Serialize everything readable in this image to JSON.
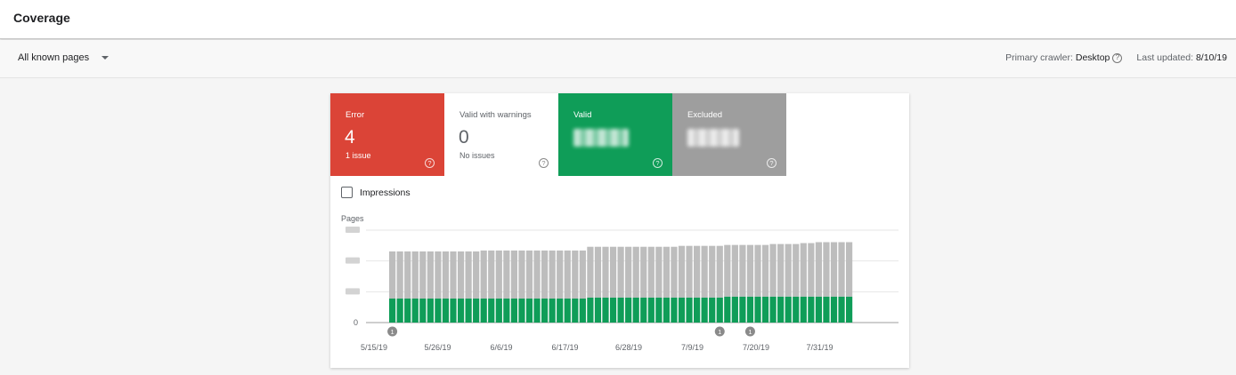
{
  "header": {
    "title": "Coverage"
  },
  "filter": {
    "page_select": "All known pages",
    "crawler_label": "Primary crawler:",
    "crawler_value": "Desktop",
    "updated_label": "Last updated:",
    "updated_value": "8/10/19"
  },
  "tiles": {
    "error": {
      "label": "Error",
      "value": "4",
      "sub": "1 issue",
      "color": "#db4437"
    },
    "warnings": {
      "label": "Valid with warnings",
      "value": "0",
      "sub": "No issues"
    },
    "valid": {
      "label": "Valid",
      "color": "#0f9d58"
    },
    "excluded": {
      "label": "Excluded",
      "color": "#9e9e9e"
    }
  },
  "impressions": {
    "label": "Impressions",
    "checked": false
  },
  "chart_data": {
    "type": "bar",
    "ylabel": "Pages",
    "y_tick_labels": [
      "0"
    ],
    "x_tick_labels": [
      "5/15/19",
      "5/26/19",
      "6/6/19",
      "6/17/19",
      "6/28/19",
      "7/9/19",
      "7/20/19",
      "7/31/19"
    ],
    "stacked": true,
    "bar_count": 61,
    "series": [
      {
        "color": "#0f9d58",
        "values": [
          0.26,
          0.26,
          0.26,
          0.26,
          0.26,
          0.26,
          0.26,
          0.26,
          0.26,
          0.26,
          0.26,
          0.26,
          0.26,
          0.26,
          0.26,
          0.26,
          0.26,
          0.26,
          0.26,
          0.26,
          0.26,
          0.26,
          0.26,
          0.26,
          0.26,
          0.26,
          0.27,
          0.27,
          0.27,
          0.27,
          0.27,
          0.27,
          0.27,
          0.27,
          0.27,
          0.27,
          0.27,
          0.27,
          0.27,
          0.27,
          0.27,
          0.27,
          0.27,
          0.27,
          0.28,
          0.28,
          0.28,
          0.28,
          0.28,
          0.28,
          0.28,
          0.28,
          0.28,
          0.28,
          0.28,
          0.28,
          0.28,
          0.28,
          0.28,
          0.28,
          0.28
        ]
      },
      {
        "color": "#bdbdbd",
        "values": [
          0.51,
          0.51,
          0.51,
          0.51,
          0.51,
          0.51,
          0.51,
          0.51,
          0.51,
          0.51,
          0.51,
          0.51,
          0.52,
          0.52,
          0.52,
          0.52,
          0.52,
          0.52,
          0.52,
          0.52,
          0.52,
          0.52,
          0.52,
          0.52,
          0.52,
          0.52,
          0.55,
          0.55,
          0.55,
          0.55,
          0.55,
          0.55,
          0.55,
          0.55,
          0.55,
          0.55,
          0.55,
          0.55,
          0.56,
          0.56,
          0.56,
          0.56,
          0.56,
          0.56,
          0.56,
          0.56,
          0.56,
          0.56,
          0.56,
          0.56,
          0.57,
          0.57,
          0.57,
          0.57,
          0.58,
          0.58,
          0.59,
          0.59,
          0.59,
          0.59,
          0.59
        ]
      }
    ],
    "annotations": [
      {
        "label": "1",
        "bar_index": 0
      },
      {
        "label": "1",
        "bar_index": 43
      },
      {
        "label": "1",
        "bar_index": 47
      }
    ]
  }
}
